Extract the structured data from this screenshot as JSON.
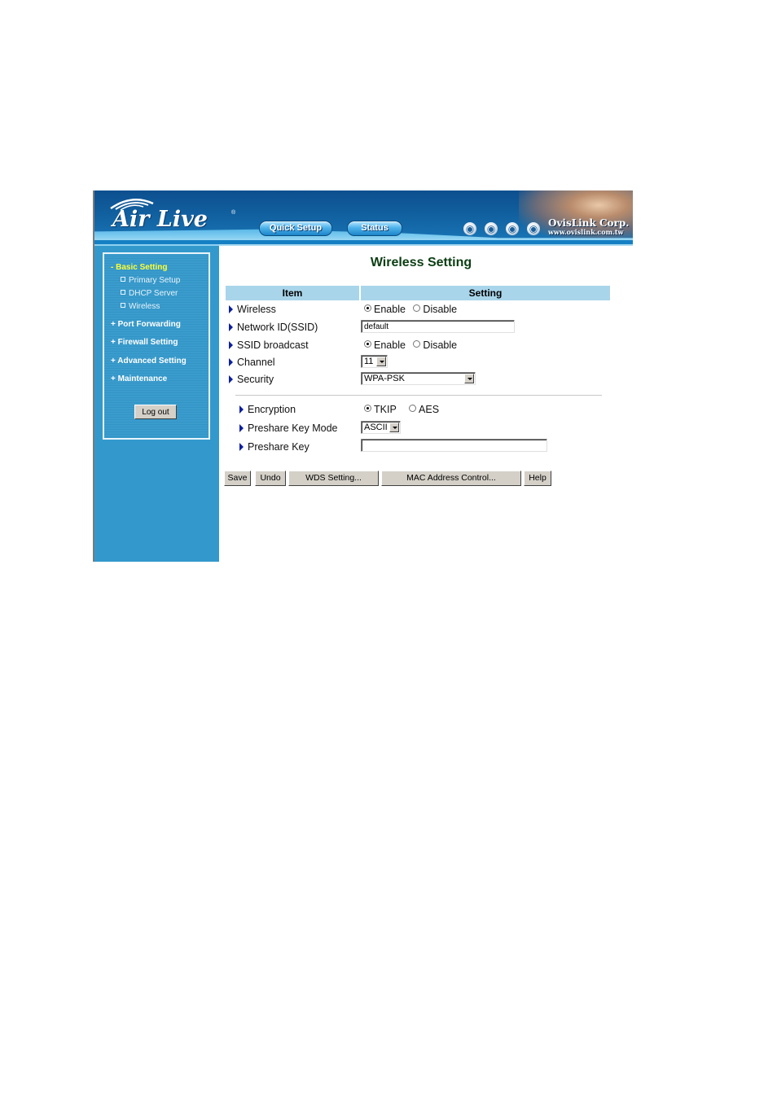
{
  "header": {
    "logo_text": "Air Live",
    "logo_mark": "®",
    "nav_buttons": [
      {
        "label": "Quick Setup"
      },
      {
        "label": "Status"
      }
    ],
    "globe_icons": [
      "globe-icon",
      "globe-icon",
      "globe-icon",
      "globe-icon"
    ],
    "corp_name": "OvisLink Corp.",
    "corp_url": "www.ovislink.com.tw"
  },
  "sidebar": {
    "sections": [
      {
        "prefix": "-",
        "label": "Basic Setting",
        "active": true,
        "items": [
          {
            "label": "Primary Setup"
          },
          {
            "label": "DHCP Server"
          },
          {
            "label": "Wireless"
          }
        ]
      },
      {
        "prefix": "+",
        "label": "Port Forwarding"
      },
      {
        "prefix": "+",
        "label": "Firewall Setting"
      },
      {
        "prefix": "+",
        "label": "Advanced Setting"
      },
      {
        "prefix": "+",
        "label": "Maintenance"
      }
    ],
    "logout_label": "Log out"
  },
  "main": {
    "title": "Wireless Setting",
    "table_headers": [
      "Item",
      "Setting"
    ],
    "rows": [
      {
        "label": "Wireless",
        "type": "radio",
        "options": [
          "Enable",
          "Disable"
        ],
        "selected": "Enable"
      },
      {
        "label": "Network ID(SSID)",
        "type": "text",
        "value": "default"
      },
      {
        "label": "SSID broadcast",
        "type": "radio",
        "options": [
          "Enable",
          "Disable"
        ],
        "selected": "Enable"
      },
      {
        "label": "Channel",
        "type": "select",
        "value": "11"
      },
      {
        "label": "Security",
        "type": "select",
        "value": "WPA-PSK"
      }
    ],
    "security_rows": [
      {
        "label": "Encryption",
        "type": "radio",
        "options": [
          "TKIP",
          "AES"
        ],
        "selected": "TKIP"
      },
      {
        "label": "Preshare Key Mode",
        "type": "select",
        "value": "ASCII"
      },
      {
        "label": "Preshare Key",
        "type": "text",
        "value": ""
      }
    ],
    "buttons": [
      {
        "label": "Save"
      },
      {
        "label": "Undo"
      },
      {
        "label": "WDS Setting..."
      },
      {
        "label": "MAC Address Control..."
      },
      {
        "label": "Help"
      }
    ]
  },
  "colors": {
    "banner_blue": "#11609f",
    "sidebar_blue": "#3399cc",
    "active_nav": "#ffff33",
    "table_header": "#a9d5ea",
    "title_green": "#0b3d12",
    "bullet_arrow": "#0b1fa0"
  }
}
